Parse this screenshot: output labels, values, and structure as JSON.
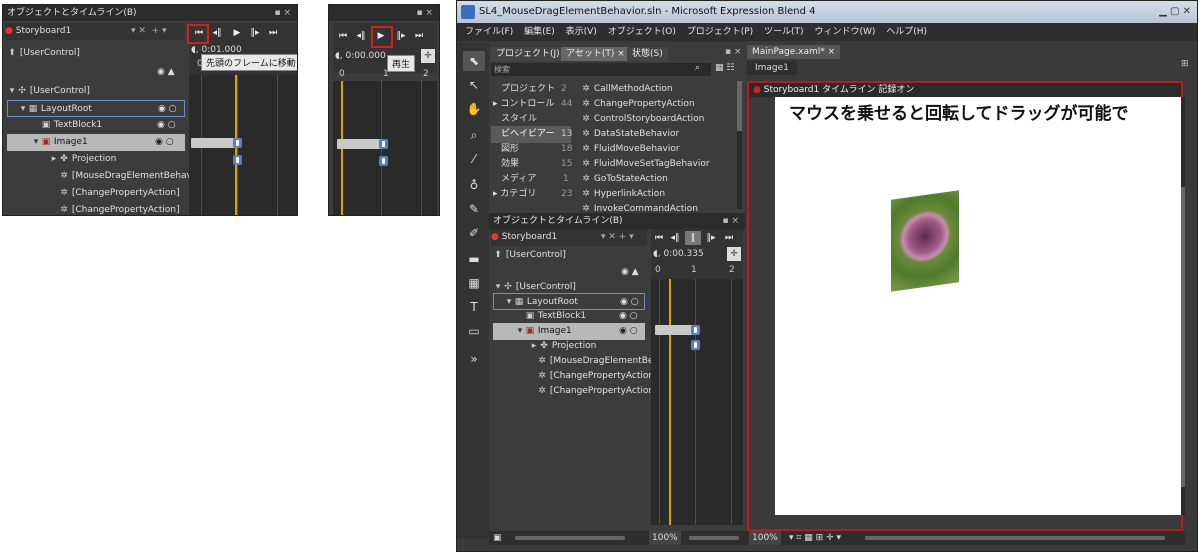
{
  "panel_left": {
    "title": "オブジェクトとタイムライン(B)",
    "storyboard": "Storyboard1",
    "root": "[UserControl]",
    "time": "0:01.000",
    "tooltip": "先頭のフレームに移動",
    "ruler": [
      "0",
      "1",
      "2"
    ],
    "tree": [
      {
        "label": "[UserControl]"
      },
      {
        "label": "LayoutRoot"
      },
      {
        "label": "TextBlock1"
      },
      {
        "label": "Image1"
      },
      {
        "label": "Projection"
      },
      {
        "label": "[MouseDragElementBehav"
      },
      {
        "label": "[ChangePropertyAction]"
      },
      {
        "label": "[ChangePropertyAction]"
      }
    ]
  },
  "panel_mid": {
    "time": "0:00.000",
    "tooltip": "再生",
    "ruler": [
      "0",
      "1",
      "2"
    ]
  },
  "blend": {
    "title": "SL4_MouseDragElementBehavior.sln - Microsoft Expression Blend 4",
    "menu": [
      "ファイル(F)",
      "編集(E)",
      "表示(V)",
      "オブジェクト(O)",
      "プロジェクト(P)",
      "ツール(T)",
      "ウィンドウ(W)",
      "ヘルプ(H)"
    ],
    "tabs": [
      "プロジェクト(J)",
      "アセット(T) ×",
      "状態(S)"
    ],
    "search_placeholder": "検索",
    "categories": [
      {
        "label": "プロジェクト",
        "count": "2"
      },
      {
        "label": "コントロール",
        "count": "44"
      },
      {
        "label": "スタイル",
        "count": ""
      },
      {
        "label": "ビヘイビアー",
        "count": "13"
      },
      {
        "label": "図形",
        "count": "18"
      },
      {
        "label": "効果",
        "count": "15"
      },
      {
        "label": "メディア",
        "count": "1"
      },
      {
        "label": "カテゴリ",
        "count": "23"
      }
    ],
    "behaviors": [
      "CallMethodAction",
      "ChangePropertyAction",
      "ControlStoryboardAction",
      "DataStateBehavior",
      "FluidMoveBehavior",
      "FluidMoveSetTagBehavior",
      "GoToStateAction",
      "HyperlinkAction",
      "InvokeCommandAction"
    ],
    "timeline_title": "オブジェクトとタイムライン(B)",
    "storyboard": "Storyboard1",
    "root": "[UserControl]",
    "time": "0:00.335",
    "ruler": [
      "0",
      "1",
      "2"
    ],
    "tree": [
      {
        "label": "[UserControl]"
      },
      {
        "label": "LayoutRoot"
      },
      {
        "label": "TextBlock1"
      },
      {
        "label": "Image1"
      },
      {
        "label": "Projection"
      },
      {
        "label": "[MouseDragElementBehav"
      },
      {
        "label": "[ChangePropertyAction]"
      },
      {
        "label": "[ChangePropertyAction]"
      }
    ],
    "doc_tab": "MainPage.xaml* ×",
    "breadcrumb": "Image1",
    "recording": "Storyboard1 タイムライン 記録オン",
    "canvas_text": "マウスを乗せると回転してドラッグが可能で",
    "zoom_left": "100%",
    "zoom_right": "100%",
    "colors": {
      "record": "#d02020",
      "playhead": "#d9a300",
      "key": "#5b7fc4"
    }
  }
}
